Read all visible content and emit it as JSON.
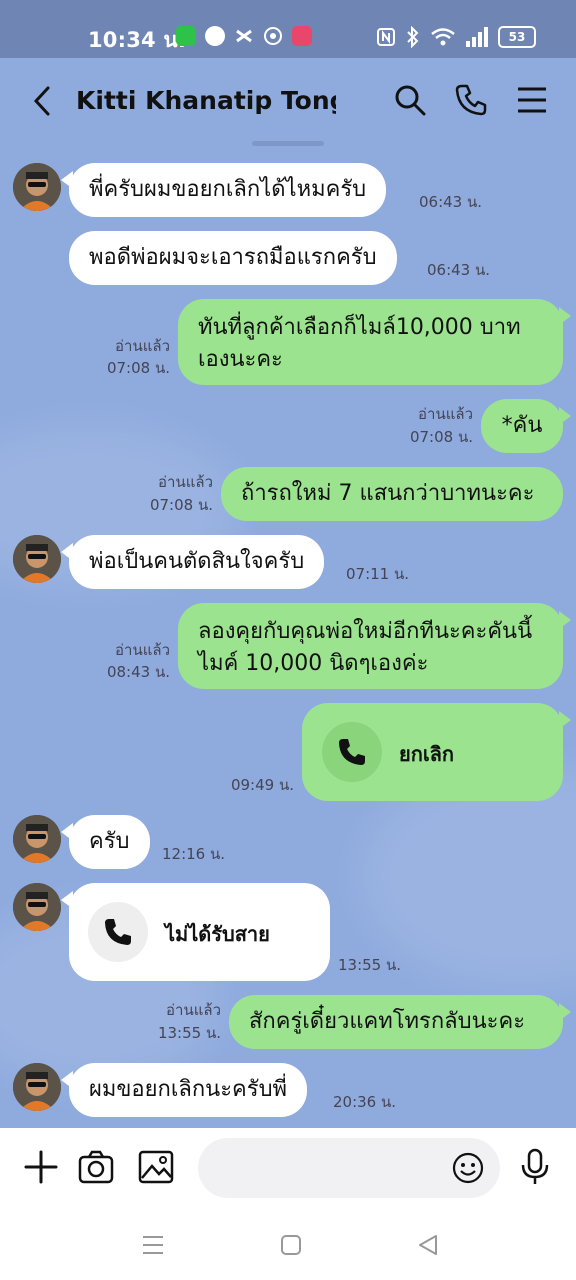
{
  "status_bar": {
    "time": "10:34 น.",
    "battery": "53",
    "notification_icons": [
      "line-connect-icon",
      "line-icon",
      "capcut-icon",
      "shopee-icon",
      "love-app-icon"
    ],
    "system_icons": [
      "nfc-icon",
      "bluetooth-icon",
      "wifi-icon",
      "signal-icon"
    ]
  },
  "header": {
    "title": "Kitti Khanatip Tongd",
    "icons": [
      "back-arrow-icon",
      "search-icon",
      "phone-icon",
      "menu-icon"
    ]
  },
  "messages": [
    {
      "from": "them",
      "text": "พี่ครับผมขอยกเลิกได้ไหมครับ",
      "time": "06:43 น."
    },
    {
      "from": "them",
      "text": "พอดีพ่อผมจะเอารถมือแรกครับ",
      "time": "06:43 น."
    },
    {
      "from": "me",
      "text": "ทันที่ลูกค้าเลือกก็ไมล์10,000 บาท เองนะคะ",
      "read": "อ่านแล้ว",
      "time": "07:08 น."
    },
    {
      "from": "me",
      "text": "*คัน",
      "read": "อ่านแล้ว",
      "time": "07:08 น."
    },
    {
      "from": "me",
      "text": "ถ้ารถใหม่ 7 แสนกว่าบาทนะคะ",
      "read": "อ่านแล้ว",
      "time": "07:08 น."
    },
    {
      "from": "them",
      "text": "พ่อเป็นคนตัดสินใจครับ",
      "time": "07:11 น."
    },
    {
      "from": "me",
      "text": "ลองคุยกับคุณพ่อใหม่อีกทีนะคะคันนี้ไมค์ 10,000 นิดๆเองค่ะ",
      "read": "อ่านแล้ว",
      "time": "08:43 น."
    },
    {
      "from": "me",
      "type": "call",
      "text": "ยกเลิก",
      "time": "09:49 น."
    },
    {
      "from": "them",
      "text": "ครับ",
      "time": "12:16 น."
    },
    {
      "from": "them",
      "type": "call",
      "text": "ไม่ได้รับสาย",
      "time": "13:55 น."
    },
    {
      "from": "me",
      "text": "สักครู่เดี๋ยวแคทโทรกลับนะคะ",
      "read": "อ่านแล้ว",
      "time": "13:55 น."
    },
    {
      "from": "them",
      "text": "ผมขอยกเลิกนะครับพี่",
      "time": "20:36 น."
    }
  ],
  "input_bar": {
    "placeholder": "",
    "icons": [
      "plus-icon",
      "camera-icon",
      "image-icon",
      "emoji-icon",
      "microphone-icon"
    ]
  },
  "nav_bar": {
    "icons": [
      "recent-apps-icon",
      "home-icon",
      "back-icon"
    ]
  },
  "colors": {
    "status_bar": "#6f86b4",
    "chat_background": "#8fabde",
    "incoming_bubble": "#ffffff",
    "outgoing_bubble": "#9be38e"
  }
}
